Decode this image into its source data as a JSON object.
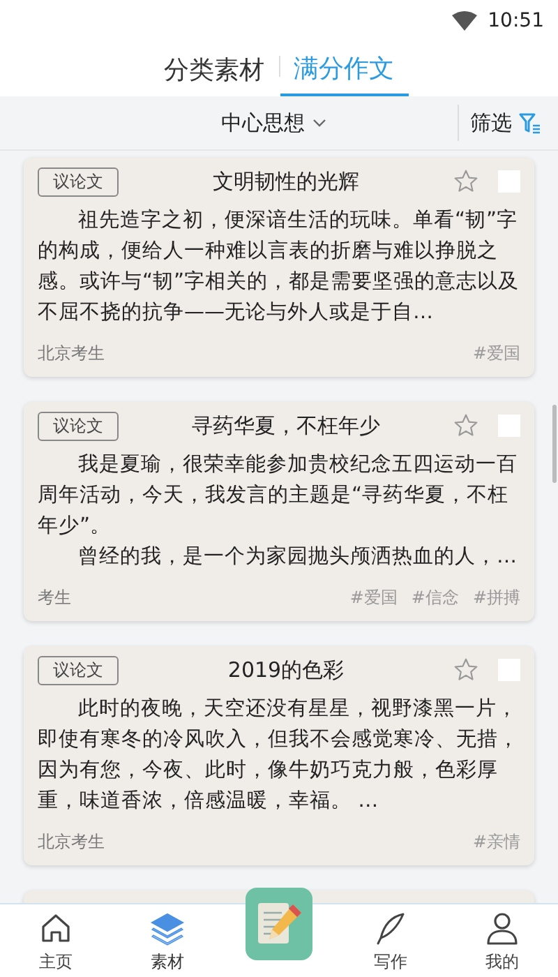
{
  "status_bar": {
    "time": "10:51"
  },
  "tabs": [
    {
      "label": "分类素材",
      "selected": false
    },
    {
      "label": "满分作文",
      "selected": true
    }
  ],
  "filter_bar": {
    "dropdown": "中心思想",
    "filter_button": "筛选"
  },
  "essays": [
    {
      "genre": "议论文",
      "title": "文明韧性的光辉",
      "favorited": false,
      "checked": false,
      "paragraphs": [
        "祖先造字之初，便深谙生活的玩味。单看“韧”字的构成，便给人一种难以言表的折磨与难以挣脱之感。或许与“韧”字相关的，都是需要坚强的意志以及不屈不挠的抗争——无论与外人或是于自…"
      ],
      "author": "北京考生",
      "tags": [
        "#爱国"
      ]
    },
    {
      "genre": "议论文",
      "title": "寻药华夏，不枉年少",
      "favorited": false,
      "checked": false,
      "paragraphs": [
        "我是夏瑜，很荣幸能参加贵校纪念五四运动一百周年活动，今天，我发言的主题是“寻药华夏，不枉年少”。",
        "曾经的我，是一个为家园抛头颅洒热血的人，…"
      ],
      "author": "考生",
      "tags": [
        "#爱国",
        "#信念",
        "#拼搏"
      ]
    },
    {
      "genre": "议论文",
      "title": "2019的色彩",
      "favorited": false,
      "checked": false,
      "paragraphs": [
        "此时的夜晚，天空还没有星星，视野漆黑一片，即使有寒冬的冷风吹入，但我不会感觉寒冷、无措，因为有您，今夜、此时，像牛奶巧克力般，色彩厚重，味道香浓，倍感温暖，幸福。 …"
      ],
      "author": "北京考生",
      "tags": [
        "#亲情"
      ]
    }
  ],
  "bottom_nav": [
    {
      "label": "主页",
      "kind": "home",
      "selected": false
    },
    {
      "label": "素材",
      "kind": "layers",
      "selected": true
    },
    {
      "kind": "compose",
      "selected": false
    },
    {
      "label": "写作",
      "kind": "quill",
      "selected": false
    },
    {
      "label": "我的",
      "kind": "person",
      "selected": false
    }
  ]
}
